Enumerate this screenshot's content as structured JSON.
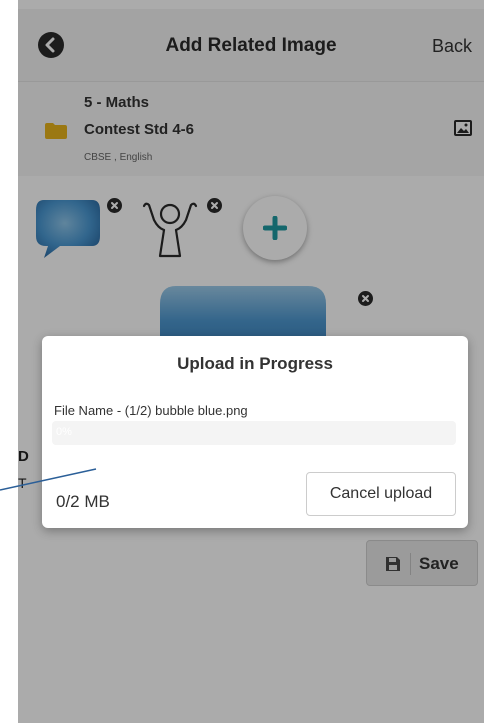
{
  "header": {
    "title": "Add Related Image",
    "back_label": "Back",
    "back_icon": "arrow-left-circle-icon"
  },
  "folder": {
    "line1": "5 - Maths",
    "line2": "Contest Std 4-6",
    "meta": "CBSE , English",
    "icon": "folder-icon",
    "image_icon": "image-icon"
  },
  "thumbnails": [
    {
      "name": "blue-speech-bubble",
      "icon": "speech-bubble-icon"
    },
    {
      "name": "raised-hands-figure",
      "icon": "person-raised-hands-icon"
    }
  ],
  "add_button_icon": "plus-icon",
  "main_preview": {
    "icon": "blue-bubble-image"
  },
  "section": {
    "letter": "D",
    "sub": "T"
  },
  "save": {
    "label": "Save",
    "icon": "floppy-disk-icon"
  },
  "modal": {
    "title": "Upload in Progress",
    "file_label": "File Name - (1/2) bubble blue.png",
    "progress_text": "0%",
    "progress_fraction": 0.0,
    "size_text": "0/2 MB",
    "cancel_label": "Cancel upload"
  },
  "colors": {
    "accent_teal": "#1e9aa2",
    "folder_yellow": "#e8b41b",
    "bubble_blue": "#3d8fcf",
    "progress_blue": "#337ab7",
    "callout_line": "#2b5f98"
  }
}
